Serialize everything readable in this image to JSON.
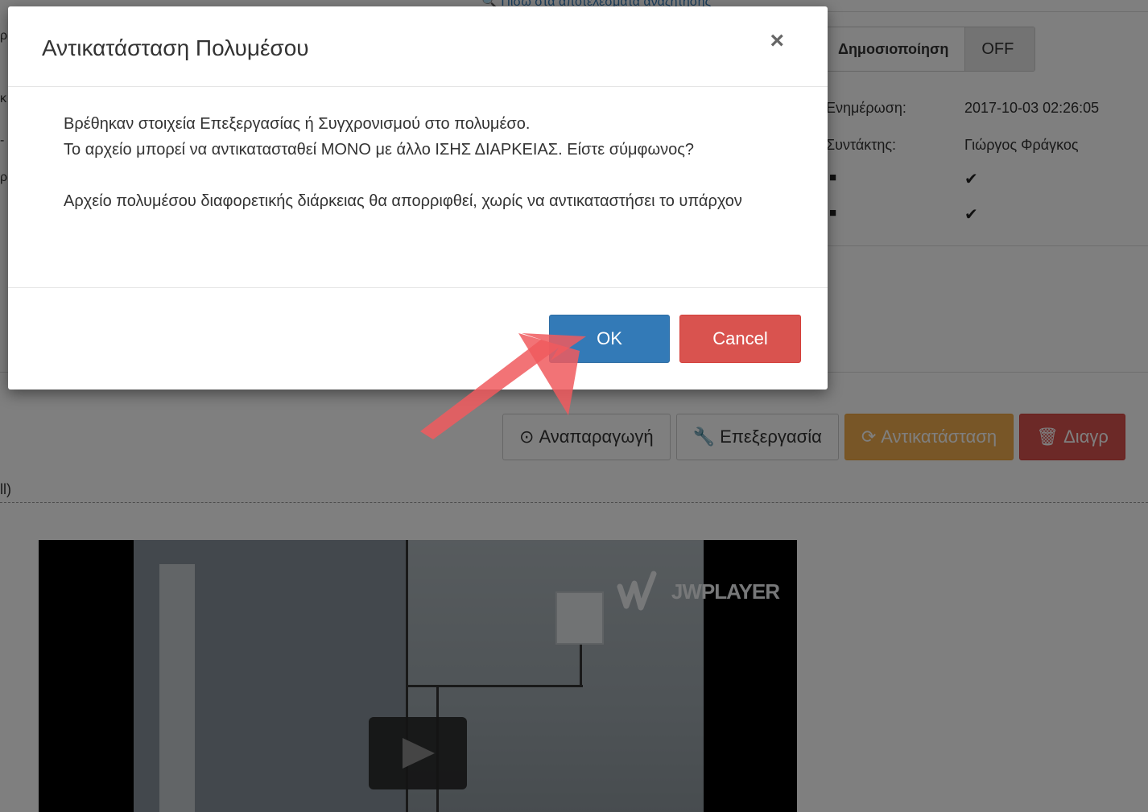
{
  "background": {
    "top_link": "Πίσω στα αποτελέσματα αναζήτησης",
    "publish": {
      "label": "Δημοσιοποίηση",
      "state": "OFF"
    },
    "info": {
      "updated_label": "Ενημέρωση:",
      "updated_value": "2017-10-03 02:26:05",
      "editor_label": "Συντάκτης:",
      "editor_value": "Γιώργος Φράγκος"
    },
    "actions": {
      "play": "Αναπαραγωγή",
      "edit": "Επεξεργασία",
      "replace": "Αντικατάσταση",
      "delete": "Διαγρ"
    },
    "section_label": "ll)",
    "player_brand": "JWPLAYER"
  },
  "modal": {
    "title": "Αντικατάσταση Πολυμέσου",
    "close": "×",
    "message_line1": "Βρέθηκαν στοιχεία Επεξεργασίας ή Συγχρονισμού στο πολυμέσο.",
    "message_line2": "Το αρχείο μπορεί να αντικατασταθεί ΜΟΝΟ με άλλο ΙΣΗΣ ΔΙΑΡΚΕΙΑΣ. Είστε σύμφωνος?",
    "message_line3": "Αρχείο πολυμέσου διαφορετικής διάρκειας θα απορριφθεί, χωρίς να αντικαταστήσει το υπάρχον",
    "ok_label": "OK",
    "cancel_label": "Cancel"
  },
  "colors": {
    "primary": "#337ab7",
    "danger": "#d9534f",
    "warning": "#f0ad4e",
    "arrow": "#f05a5e"
  }
}
